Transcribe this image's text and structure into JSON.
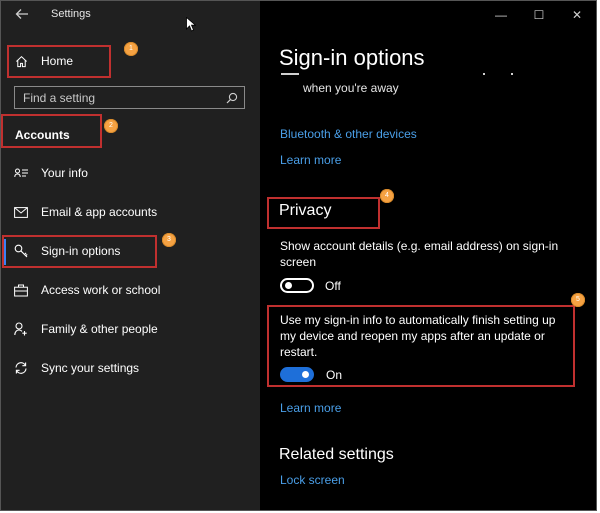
{
  "window": {
    "title": "Settings",
    "controls": {
      "minimize": "—",
      "maximize": "☐",
      "close": "✕"
    }
  },
  "sidebar": {
    "home_label": "Home",
    "search_placeholder": "Find a setting",
    "section_header": "Accounts",
    "items": [
      {
        "label": "Your info",
        "icon": "contact-card-icon"
      },
      {
        "label": "Email & app accounts",
        "icon": "mail-icon"
      },
      {
        "label": "Sign-in options",
        "icon": "key-icon",
        "selected": true
      },
      {
        "label": "Access work or school",
        "icon": "briefcase-icon"
      },
      {
        "label": "Family & other people",
        "icon": "person-add-icon"
      },
      {
        "label": "Sync your settings",
        "icon": "sync-icon"
      }
    ]
  },
  "main": {
    "page_title": "Sign-in options",
    "partial_text": "when you're away",
    "bluetooth_link": "Bluetooth & other devices",
    "learn_more_1": "Learn more",
    "privacy": {
      "title": "Privacy",
      "account_details_desc": "Show account details (e.g. email address) on sign-in screen",
      "account_details_toggle": "Off",
      "auto_finish_desc": "Use my sign-in info to automatically finish setting up my device and reopen my apps after an update or restart.",
      "auto_finish_toggle": "On"
    },
    "learn_more_2": "Learn more",
    "related": {
      "title": "Related settings",
      "lock_screen_link": "Lock screen"
    }
  },
  "annotations": [
    "1",
    "2",
    "3",
    "4",
    "5"
  ],
  "colors": {
    "accent": "#4a9fe8",
    "toggle_on": "#1e6fd9",
    "annotation_box": "#c0302f",
    "annotation_badge": "#f5a243"
  }
}
